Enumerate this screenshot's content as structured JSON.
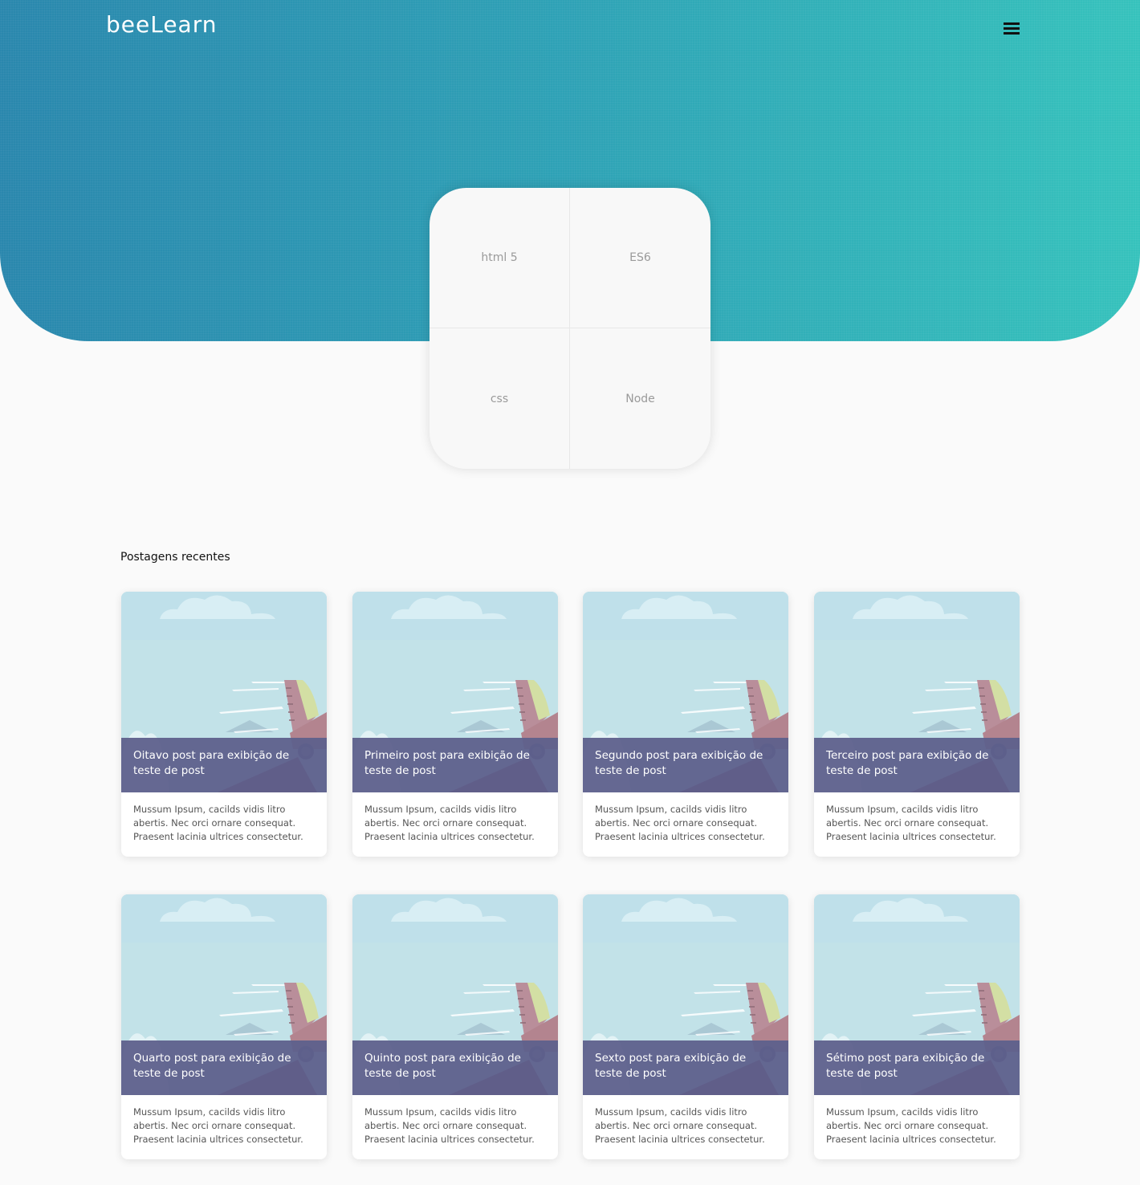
{
  "header": {
    "brand": "beeLearn",
    "menu_icon": "hamburger-menu-icon"
  },
  "tiles": [
    {
      "label": "html 5"
    },
    {
      "label": "ES6"
    },
    {
      "label": "css"
    },
    {
      "label": "Node"
    }
  ],
  "section_title": "Postagens recentes",
  "posts": [
    {
      "title": "Oitavo post para exibição de teste de post",
      "excerpt": "Mussum Ipsum, cacilds vidis litro abertis. Nec orci ornare consequat. Praesent lacinia ultrices consectetur."
    },
    {
      "title": "Primeiro post para exibição de teste de post",
      "excerpt": "Mussum Ipsum, cacilds vidis litro abertis. Nec orci ornare consequat. Praesent lacinia ultrices consectetur."
    },
    {
      "title": "Segundo post para exibição de teste de post",
      "excerpt": "Mussum Ipsum, cacilds vidis litro abertis. Nec orci ornare consequat. Praesent lacinia ultrices consectetur."
    },
    {
      "title": "Terceiro post para exibição de teste de post",
      "excerpt": "Mussum Ipsum, cacilds vidis litro abertis. Nec orci ornare consequat. Praesent lacinia ultrices consectetur."
    },
    {
      "title": "Quarto post para exibição de teste de post",
      "excerpt": "Mussum Ipsum, cacilds vidis litro abertis. Nec orci ornare consequat. Praesent lacinia ultrices consectetur."
    },
    {
      "title": "Quinto post para exibição de teste de post",
      "excerpt": "Mussum Ipsum, cacilds vidis litro abertis. Nec orci ornare consequat. Praesent lacinia ultrices consectetur."
    },
    {
      "title": "Sexto post para exibição de teste de post",
      "excerpt": "Mussum Ipsum, cacilds vidis litro abertis. Nec orci ornare consequat. Praesent lacinia ultrices consectetur."
    },
    {
      "title": "Sétimo post para exibição de teste de post",
      "excerpt": "Mussum Ipsum, cacilds vidis litro abertis. Nec orci ornare consequat. Praesent lacinia ultrices consectetur."
    }
  ],
  "colors": {
    "hero_start": "#2a87ad",
    "hero_end": "#36c2bc",
    "card_overlay": "#5e608c",
    "background": "#fafafa"
  }
}
